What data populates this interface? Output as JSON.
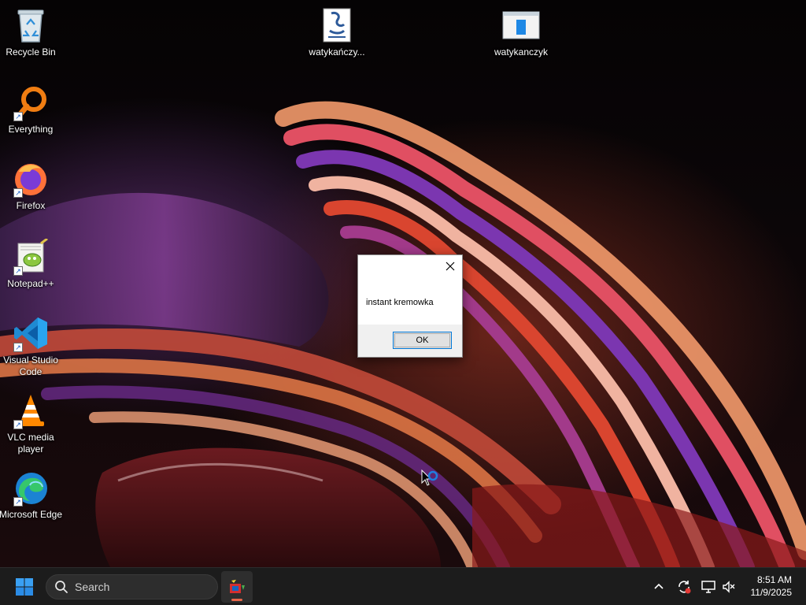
{
  "desktop": {
    "icons": [
      {
        "label": "Recycle Bin"
      },
      {
        "label": "Everything"
      },
      {
        "label": "Firefox"
      },
      {
        "label": "Notepad++"
      },
      {
        "label": "Visual Studio Code"
      },
      {
        "label": "VLC media player"
      },
      {
        "label": "Microsoft Edge"
      },
      {
        "label": "watykańczy..."
      },
      {
        "label": "watykanczyk"
      }
    ]
  },
  "dialog": {
    "message": "instant kremowka",
    "ok_label": "OK",
    "close_icon": "close-icon"
  },
  "taskbar": {
    "start_icon": "windows-logo-icon",
    "search_placeholder": "Search",
    "running_app_icon": "app-icon",
    "tray": {
      "chevron_icon": "chevron-up-icon",
      "sync_icon": "sync-icon",
      "display_icon": "display-icon",
      "volume_icon": "volume-muted-icon"
    },
    "clock": {
      "time": "8:51 AM",
      "date": "11/9/2025"
    }
  },
  "colors": {
    "taskbar_bg": "#1c1c1c",
    "accent": "#0078d7",
    "dialog_bg": "#f0f0f0"
  }
}
